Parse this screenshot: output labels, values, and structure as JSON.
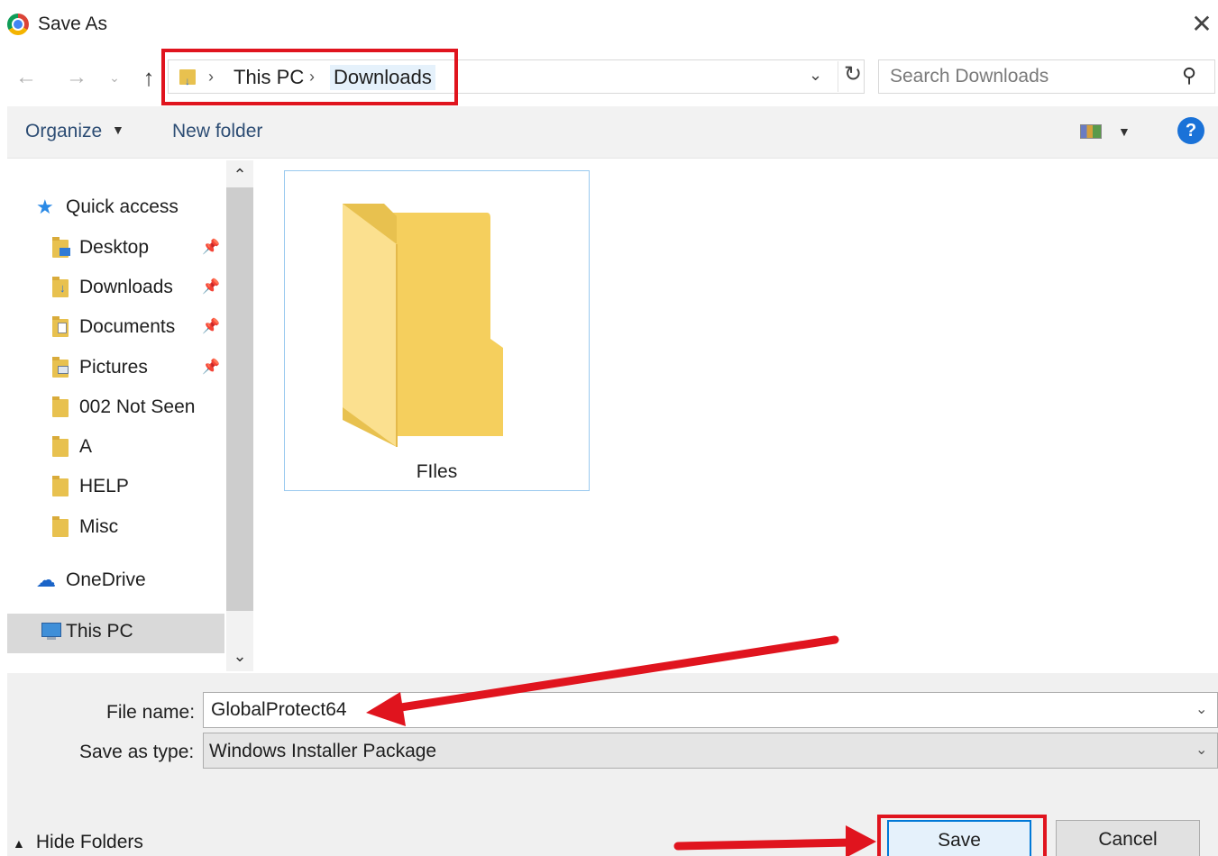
{
  "window": {
    "title": "Save As",
    "close_symbol": "✕"
  },
  "address": {
    "crumbs": [
      "This PC",
      "Downloads"
    ],
    "separator": "›"
  },
  "search": {
    "placeholder": "Search Downloads"
  },
  "toolbar": {
    "organize_label": "Organize",
    "new_folder_label": "New folder",
    "help_label": "?"
  },
  "nav": {
    "quick_access": "Quick access",
    "items": [
      {
        "label": "Desktop",
        "pinned": true
      },
      {
        "label": "Downloads",
        "pinned": true
      },
      {
        "label": "Documents",
        "pinned": true
      },
      {
        "label": "Pictures",
        "pinned": true
      },
      {
        "label": "002 Not Seen",
        "pinned": false
      },
      {
        "label": "A",
        "pinned": false
      },
      {
        "label": "HELP",
        "pinned": false
      },
      {
        "label": "Misc",
        "pinned": false
      }
    ],
    "onedrive": "OneDrive",
    "this_pc": "This PC"
  },
  "content": {
    "items": [
      {
        "name": "FIles",
        "type": "folder"
      }
    ]
  },
  "form": {
    "file_name_label": "File name:",
    "file_name_value": "GlobalProtect64",
    "save_type_label": "Save as type:",
    "save_type_value": "Windows Installer Package"
  },
  "footer": {
    "hide_folders_label": "Hide Folders",
    "save_label": "Save",
    "cancel_label": "Cancel"
  },
  "colors": {
    "annotation_red": "#e0141e",
    "accent_blue": "#0078d7"
  }
}
